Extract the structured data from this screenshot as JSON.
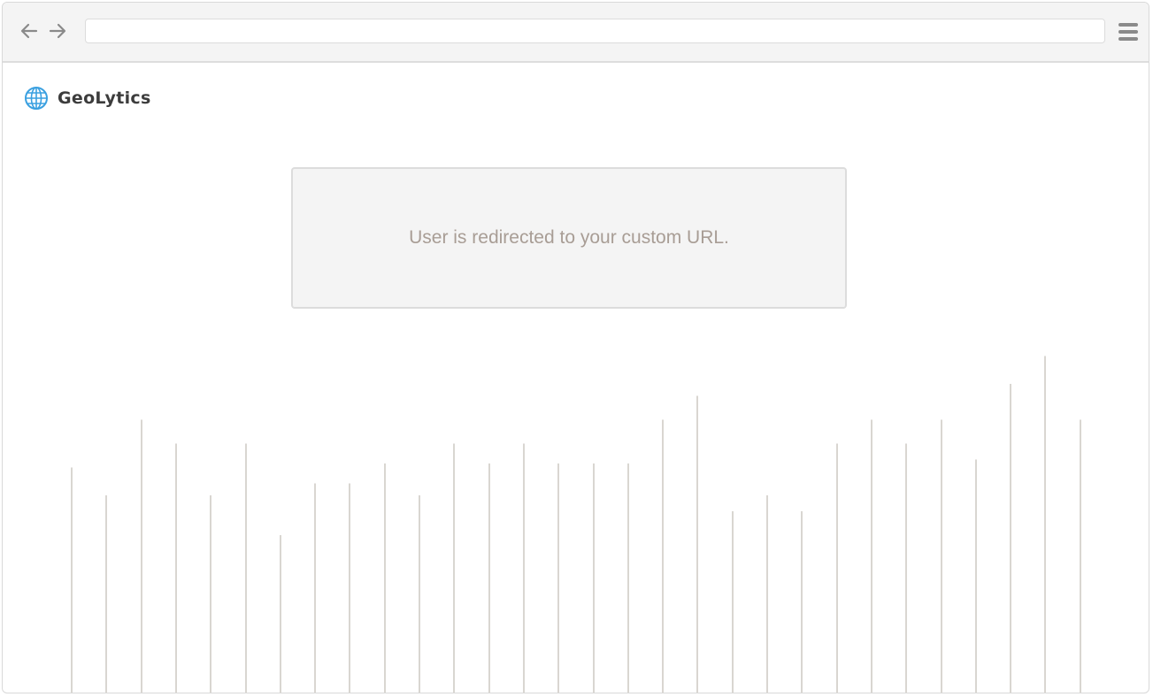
{
  "browser": {
    "back_icon": "arrow-left-icon",
    "forward_icon": "arrow-right-icon",
    "address_value": "",
    "menu_icon": "hamburger-menu-icon"
  },
  "brand": {
    "icon": "globe-icon",
    "name": "GeoLytics",
    "icon_color": "#3aa0e0"
  },
  "message": {
    "text": "User is redirected to your custom URL."
  },
  "decorative_bars": {
    "color": "#d9d6d1",
    "levels": [
      0.57,
      0.5,
      0.69,
      0.63,
      0.5,
      0.63,
      0.4,
      0.53,
      0.53,
      0.58,
      0.5,
      0.63,
      0.58,
      0.63,
      0.58,
      0.58,
      0.58,
      0.69,
      0.75,
      0.46,
      0.5,
      0.46,
      0.63,
      0.69,
      0.63,
      0.69,
      0.59,
      0.78,
      0.85,
      0.69
    ]
  }
}
